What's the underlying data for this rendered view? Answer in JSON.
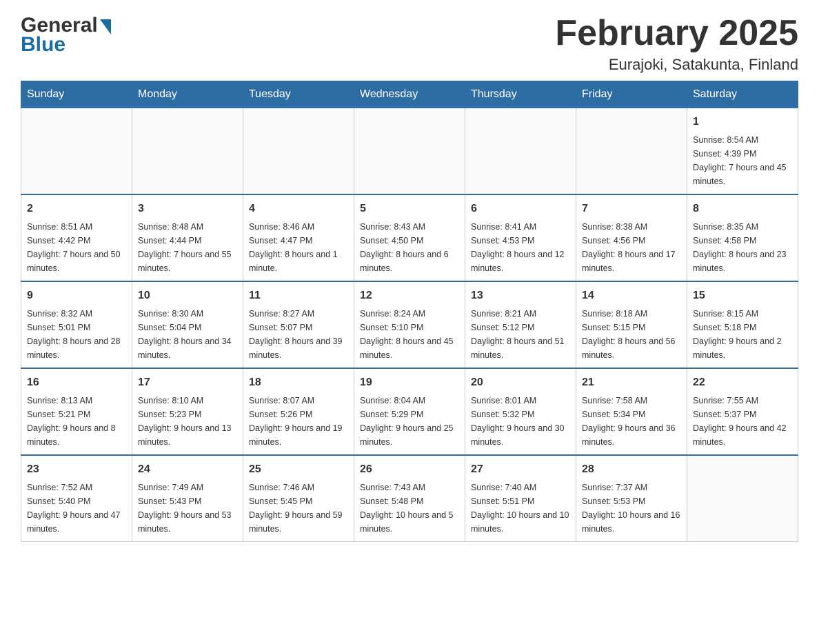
{
  "header": {
    "logo_general": "General",
    "logo_blue": "Blue",
    "title": "February 2025",
    "subtitle": "Eurajoki, Satakunta, Finland"
  },
  "weekdays": [
    "Sunday",
    "Monday",
    "Tuesday",
    "Wednesday",
    "Thursday",
    "Friday",
    "Saturday"
  ],
  "weeks": [
    [
      {
        "day": "",
        "info": ""
      },
      {
        "day": "",
        "info": ""
      },
      {
        "day": "",
        "info": ""
      },
      {
        "day": "",
        "info": ""
      },
      {
        "day": "",
        "info": ""
      },
      {
        "day": "",
        "info": ""
      },
      {
        "day": "1",
        "info": "Sunrise: 8:54 AM\nSunset: 4:39 PM\nDaylight: 7 hours and 45 minutes."
      }
    ],
    [
      {
        "day": "2",
        "info": "Sunrise: 8:51 AM\nSunset: 4:42 PM\nDaylight: 7 hours and 50 minutes."
      },
      {
        "day": "3",
        "info": "Sunrise: 8:48 AM\nSunset: 4:44 PM\nDaylight: 7 hours and 55 minutes."
      },
      {
        "day": "4",
        "info": "Sunrise: 8:46 AM\nSunset: 4:47 PM\nDaylight: 8 hours and 1 minute."
      },
      {
        "day": "5",
        "info": "Sunrise: 8:43 AM\nSunset: 4:50 PM\nDaylight: 8 hours and 6 minutes."
      },
      {
        "day": "6",
        "info": "Sunrise: 8:41 AM\nSunset: 4:53 PM\nDaylight: 8 hours and 12 minutes."
      },
      {
        "day": "7",
        "info": "Sunrise: 8:38 AM\nSunset: 4:56 PM\nDaylight: 8 hours and 17 minutes."
      },
      {
        "day": "8",
        "info": "Sunrise: 8:35 AM\nSunset: 4:58 PM\nDaylight: 8 hours and 23 minutes."
      }
    ],
    [
      {
        "day": "9",
        "info": "Sunrise: 8:32 AM\nSunset: 5:01 PM\nDaylight: 8 hours and 28 minutes."
      },
      {
        "day": "10",
        "info": "Sunrise: 8:30 AM\nSunset: 5:04 PM\nDaylight: 8 hours and 34 minutes."
      },
      {
        "day": "11",
        "info": "Sunrise: 8:27 AM\nSunset: 5:07 PM\nDaylight: 8 hours and 39 minutes."
      },
      {
        "day": "12",
        "info": "Sunrise: 8:24 AM\nSunset: 5:10 PM\nDaylight: 8 hours and 45 minutes."
      },
      {
        "day": "13",
        "info": "Sunrise: 8:21 AM\nSunset: 5:12 PM\nDaylight: 8 hours and 51 minutes."
      },
      {
        "day": "14",
        "info": "Sunrise: 8:18 AM\nSunset: 5:15 PM\nDaylight: 8 hours and 56 minutes."
      },
      {
        "day": "15",
        "info": "Sunrise: 8:15 AM\nSunset: 5:18 PM\nDaylight: 9 hours and 2 minutes."
      }
    ],
    [
      {
        "day": "16",
        "info": "Sunrise: 8:13 AM\nSunset: 5:21 PM\nDaylight: 9 hours and 8 minutes."
      },
      {
        "day": "17",
        "info": "Sunrise: 8:10 AM\nSunset: 5:23 PM\nDaylight: 9 hours and 13 minutes."
      },
      {
        "day": "18",
        "info": "Sunrise: 8:07 AM\nSunset: 5:26 PM\nDaylight: 9 hours and 19 minutes."
      },
      {
        "day": "19",
        "info": "Sunrise: 8:04 AM\nSunset: 5:29 PM\nDaylight: 9 hours and 25 minutes."
      },
      {
        "day": "20",
        "info": "Sunrise: 8:01 AM\nSunset: 5:32 PM\nDaylight: 9 hours and 30 minutes."
      },
      {
        "day": "21",
        "info": "Sunrise: 7:58 AM\nSunset: 5:34 PM\nDaylight: 9 hours and 36 minutes."
      },
      {
        "day": "22",
        "info": "Sunrise: 7:55 AM\nSunset: 5:37 PM\nDaylight: 9 hours and 42 minutes."
      }
    ],
    [
      {
        "day": "23",
        "info": "Sunrise: 7:52 AM\nSunset: 5:40 PM\nDaylight: 9 hours and 47 minutes."
      },
      {
        "day": "24",
        "info": "Sunrise: 7:49 AM\nSunset: 5:43 PM\nDaylight: 9 hours and 53 minutes."
      },
      {
        "day": "25",
        "info": "Sunrise: 7:46 AM\nSunset: 5:45 PM\nDaylight: 9 hours and 59 minutes."
      },
      {
        "day": "26",
        "info": "Sunrise: 7:43 AM\nSunset: 5:48 PM\nDaylight: 10 hours and 5 minutes."
      },
      {
        "day": "27",
        "info": "Sunrise: 7:40 AM\nSunset: 5:51 PM\nDaylight: 10 hours and 10 minutes."
      },
      {
        "day": "28",
        "info": "Sunrise: 7:37 AM\nSunset: 5:53 PM\nDaylight: 10 hours and 16 minutes."
      },
      {
        "day": "",
        "info": ""
      }
    ]
  ]
}
